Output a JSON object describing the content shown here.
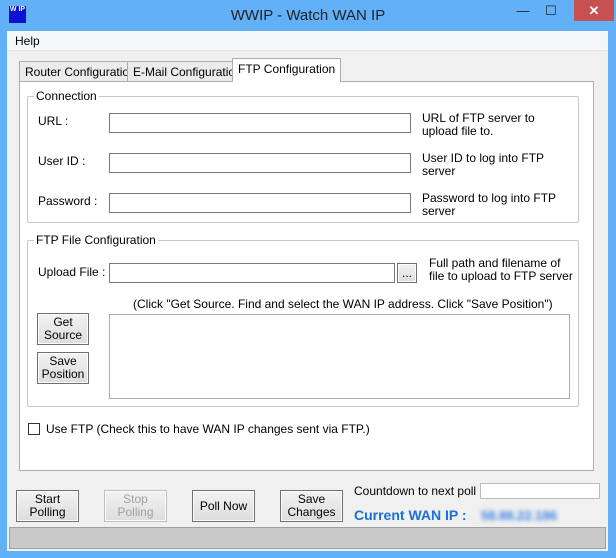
{
  "window": {
    "title": "WWIP - Watch WAN IP",
    "icon_text": "W IP",
    "minimize": "—",
    "maximize": "☐",
    "close": "✕"
  },
  "menu": {
    "help": "Help"
  },
  "tabs": [
    {
      "label": "Router Configuration"
    },
    {
      "label": "E-Mail Configuration"
    },
    {
      "label": "FTP Configuration",
      "active": true
    }
  ],
  "connection": {
    "legend": "Connection",
    "url_label": "URL :",
    "url_value": "",
    "url_help": "URL of FTP server to upload file to.",
    "userid_label": "User ID :",
    "userid_value": "",
    "userid_help": "User ID to log into FTP server",
    "password_label": "Password :",
    "password_value": "",
    "password_help": "Password to log into FTP server"
  },
  "ftp_file": {
    "legend": "FTP File Configuration",
    "upload_label": "Upload File :",
    "upload_value": "",
    "browse_label": "...",
    "upload_help": "Full path and filename of file to upload to FTP server",
    "instructions": "(Click \"Get Source. Find and select the WAN IP address. Click \"Save Position\")",
    "get_source": "Get Source",
    "save_position": "Save Position",
    "source_text": ""
  },
  "use_ftp": {
    "label": "Use FTP (Check this to have WAN IP changes sent via FTP.)",
    "checked": false
  },
  "buttons": {
    "start": "Start Polling",
    "stop": "Stop Polling",
    "poll": "Poll Now",
    "save": "Save Changes"
  },
  "countdown": {
    "label": "Countdown to next poll :",
    "value": ""
  },
  "wan": {
    "label": "Current WAN IP :",
    "value": "58.88.22.186",
    "color": "#1a6fd8"
  }
}
